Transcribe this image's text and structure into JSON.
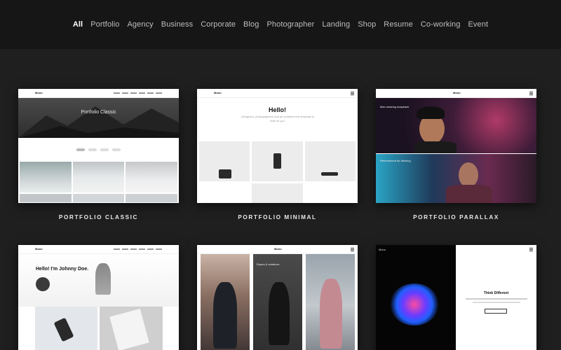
{
  "filters": [
    "All",
    "Portfolio",
    "Agency",
    "Business",
    "Corporate",
    "Blog",
    "Photographer",
    "Landing",
    "Shop",
    "Resume",
    "Co-working",
    "Event"
  ],
  "active_filter": "All",
  "cards": [
    {
      "caption": "PORTFOLIO CLASSIC",
      "hero_title": "Portfolio Classic",
      "logo": "Mono"
    },
    {
      "caption": "PORTFOLIO MINIMAL",
      "hero_title": "Hello!",
      "sub": "Designers, photographers and all creatives this template is built for you.",
      "logo": "Mono"
    },
    {
      "caption": "PORTFOLIO PARALLAX",
      "overlay_1": "Man wearing snapback",
      "overlay_2": "Refreshment for thinking",
      "logo": "Mono"
    },
    {
      "hero_title": "Hello! I'm Johnny Doe.",
      "logo": "Mono"
    },
    {
      "logo": "Mono",
      "overlay_1": "Ropes & creatives"
    },
    {
      "logo": "Mono",
      "hero_title": "Think Different"
    }
  ],
  "colors": {
    "background": "#1f1f1f",
    "topbar": "#161616",
    "active": "#ffffff",
    "inactive": "#bdbdbd"
  }
}
